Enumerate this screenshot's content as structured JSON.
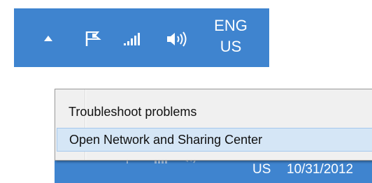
{
  "tray_top": {
    "icons": [
      "show-hidden-icons-arrow",
      "action-center-flag-icon",
      "network-signal-icon",
      "speaker-volume-icon"
    ],
    "language_line1": "ENG",
    "language_line2": "US"
  },
  "context_menu": {
    "items": [
      {
        "label": "Troubleshoot problems",
        "hovered": false
      },
      {
        "label": "Open Network and Sharing Center",
        "hovered": true
      }
    ]
  },
  "tray_bottom": {
    "language": "US",
    "date": "10/31/2012"
  },
  "colors": {
    "taskbar": "#3f84cf",
    "menu_background": "#f0f0f0",
    "menu_hover": "#d5e6f6",
    "menu_hover_border": "#a6c8ec"
  }
}
